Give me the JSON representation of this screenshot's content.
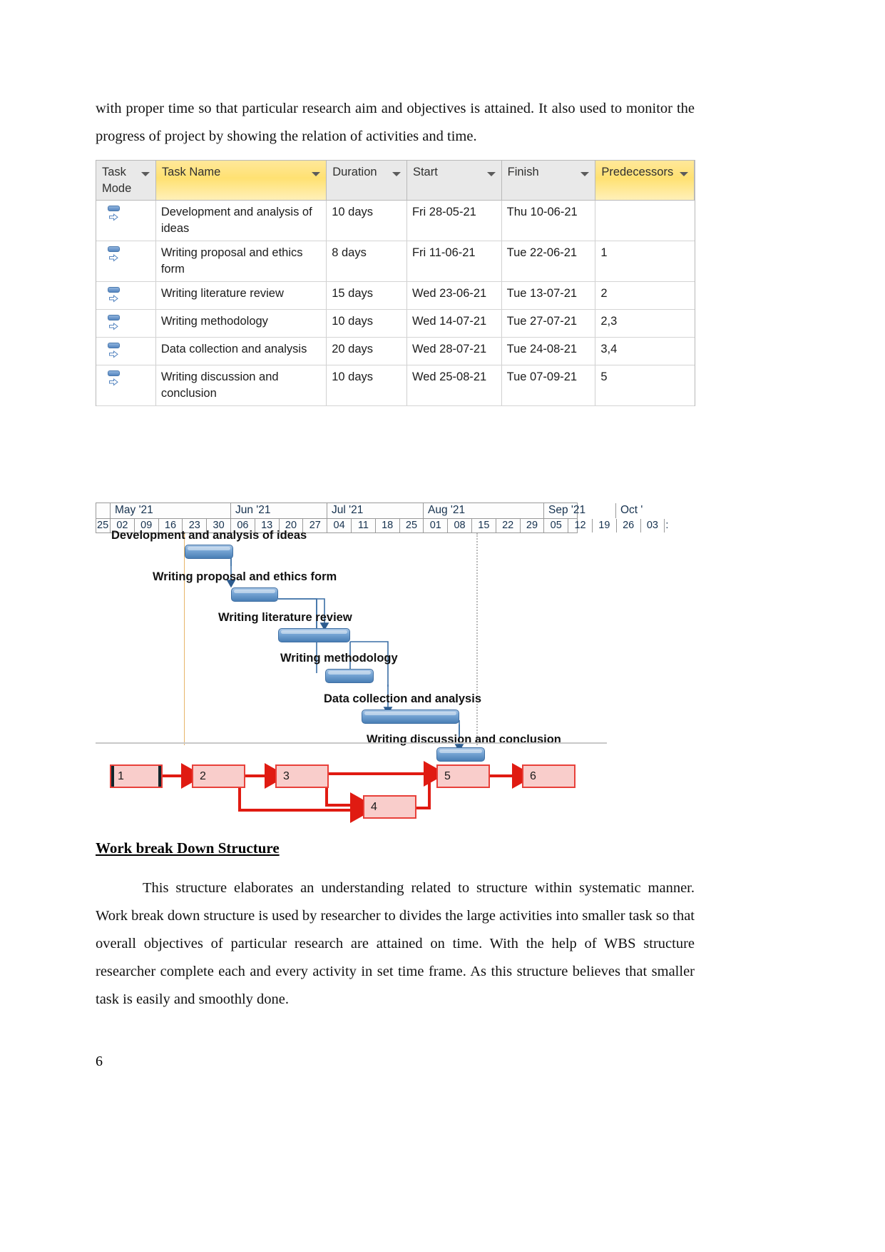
{
  "document": {
    "page_number": "6",
    "intro_paragraph": "with proper time so that particular research aim and objectives is attained. It also used to monitor the progress of project by showing the relation of activities and time.",
    "section_heading": "Work break Down Structure",
    "body_paragraph": "This structure elaborates an understanding related to structure within systematic manner. Work break down structure is used by researcher to divides the large activities into smaller task so that overall objectives of particular research are attained on time. With the help of WBS structure researcher complete each and every activity in set time frame. As this structure believes that smaller task is easily and smoothly done."
  },
  "project_table": {
    "headers": {
      "task_mode": "Task Mode",
      "task_mode_line1": "Task",
      "task_mode_line2": "Mode",
      "task_name": "Task Name",
      "duration": "Duration",
      "start": "Start",
      "finish": "Finish",
      "predecessors": "Predecessors"
    },
    "highlight_color": "#ffe172",
    "header_background": "#e9e9e9",
    "rows": [
      {
        "id": "1",
        "mode_icon": "auto-schedule-icon",
        "name": "Development and analysis of ideas",
        "duration": "10 days",
        "start": "Fri 28-05-21",
        "finish": "Thu 10-06-21",
        "predecessors": ""
      },
      {
        "id": "2",
        "mode_icon": "auto-schedule-icon",
        "name": "Writing proposal and ethics form",
        "duration": "8 days",
        "start": "Fri 11-06-21",
        "finish": "Tue 22-06-21",
        "predecessors": "1"
      },
      {
        "id": "3",
        "mode_icon": "auto-schedule-icon",
        "name": "Writing literature review",
        "duration": "15 days",
        "start": "Wed 23-06-21",
        "finish": "Tue 13-07-21",
        "predecessors": "2"
      },
      {
        "id": "4",
        "mode_icon": "auto-schedule-icon",
        "name": "Writing methodology",
        "duration": "10 days",
        "start": "Wed 14-07-21",
        "finish": "Tue 27-07-21",
        "predecessors": "2,3"
      },
      {
        "id": "5",
        "mode_icon": "auto-schedule-icon",
        "name": "Data collection and analysis",
        "duration": "20 days",
        "start": "Wed 28-07-21",
        "finish": "Tue 24-08-21",
        "predecessors": "3,4"
      },
      {
        "id": "6",
        "mode_icon": "auto-schedule-icon",
        "name": "Writing discussion and conclusion",
        "duration": "10 days",
        "start": "Wed 25-08-21",
        "finish": "Tue 07-09-21",
        "predecessors": "5"
      }
    ]
  },
  "gantt": {
    "months": [
      "May '21",
      "Jun '21",
      "Jul '21",
      "Aug '21",
      "Sep '21",
      "Oct '"
    ],
    "weeks": [
      "25",
      "02",
      "09",
      "16",
      "23",
      "30",
      "06",
      "13",
      "20",
      "27",
      "04",
      "11",
      "18",
      "25",
      "01",
      "08",
      "15",
      "22",
      "29",
      "05",
      "12",
      "19",
      "26",
      "03",
      ":"
    ],
    "bar_color": "#4a7fb5",
    "today_line_color": "#e8b56a",
    "bars": [
      {
        "label": "Development and analysis of ideas",
        "start": "Fri 28-05-21",
        "finish": "Thu 10-06-21",
        "duration": "10 days"
      },
      {
        "label": "Writing proposal and ethics form",
        "start": "Fri 11-06-21",
        "finish": "Tue 22-06-21",
        "duration": "8 days"
      },
      {
        "label": "Writing literature review",
        "start": "Wed 23-06-21",
        "finish": "Tue 13-07-21",
        "duration": "15 days"
      },
      {
        "label": "Writing methodology",
        "start": "Wed 14-07-21",
        "finish": "Tue 27-07-21",
        "duration": "10 days"
      },
      {
        "label": "Data collection and analysis",
        "start": "Wed 28-07-21",
        "finish": "Tue 24-08-21",
        "duration": "20 days"
      },
      {
        "label": "Writing discussion and conclusion",
        "start": "Wed 25-08-21",
        "finish": "Tue 07-09-21",
        "duration": "10 days"
      }
    ]
  },
  "network_diagram": {
    "node_fill": "#f9cdcb",
    "node_border": "#e8403a",
    "nodes": [
      {
        "id": "1",
        "label": "1"
      },
      {
        "id": "2",
        "label": "2"
      },
      {
        "id": "3",
        "label": "3"
      },
      {
        "id": "4",
        "label": "4"
      },
      {
        "id": "5",
        "label": "5"
      },
      {
        "id": "6",
        "label": "6"
      }
    ],
    "links": [
      "1-2",
      "2-3",
      "2-4",
      "3-4",
      "3-5",
      "4-5",
      "5-6"
    ]
  }
}
